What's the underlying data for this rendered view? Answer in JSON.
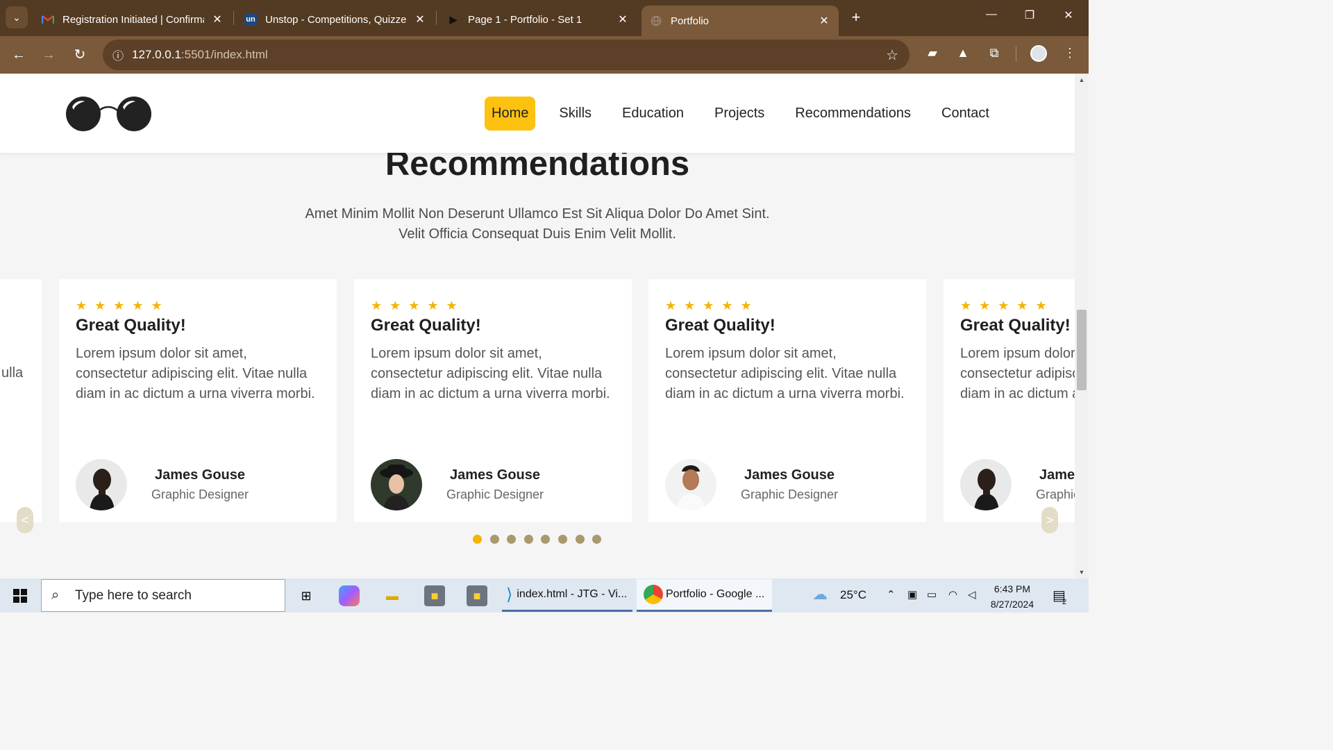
{
  "browser": {
    "tabs": [
      {
        "title": "Registration Initiated | Confirma",
        "icon": "gmail-icon"
      },
      {
        "title": "Unstop - Competitions, Quizzes",
        "icon": "unstop-icon",
        "icon_text": "un"
      },
      {
        "title": "Page 1 - Portfolio - Set 1",
        "icon": "play-icon"
      },
      {
        "title": "Portfolio",
        "icon": "globe-icon"
      }
    ],
    "url_host": "127.0.0.1",
    "url_rest": ":5501/index.html"
  },
  "site": {
    "nav": [
      "Home",
      "Skills",
      "Education",
      "Projects",
      "Recommendations",
      "Contact"
    ],
    "active_nav": "Home",
    "section_title": "Recommendations",
    "section_sub_1": "Amet Minim Mollit Non Deserunt Ullamco Est Sit Aliqua Dolor Do Amet Sint.",
    "section_sub_2": "Velit Officia Consequat Duis Enim Velit Mollit.",
    "left_fragment": "ulla",
    "cards": [
      {
        "stars": "★ ★ ★ ★ ★",
        "title": "Great Quality!",
        "text": "Lorem ipsum dolor sit amet, consectetur adipiscing elit. Vitae nulla diam in ac dictum a urna viverra morbi.",
        "name": "James Gouse",
        "role": "Graphic Designer"
      },
      {
        "stars": "★ ★ ★ ★ ★",
        "title": "Great Quality!",
        "text": "Lorem ipsum dolor sit amet, consectetur adipiscing elit. Vitae nulla diam in ac dictum a urna viverra morbi.",
        "name": "James Gouse",
        "role": "Graphic Designer"
      },
      {
        "stars": "★ ★ ★ ★ ★",
        "title": "Great Quality!",
        "text": "Lorem ipsum dolor sit amet, consectetur adipiscing elit. Vitae nulla diam in ac dictum a urna viverra morbi.",
        "name": "James Gouse",
        "role": "Graphic Designer"
      },
      {
        "stars": "★ ★ ★ ★ ★",
        "title": "Great Quality!",
        "text": "Lorem ipsum dolor sit amet, consectetur adipiscing elit. Vitae nulla diam in ac dictum a urna viverra morbi.",
        "name": "James Gouse",
        "role": "Graphic Designer"
      }
    ],
    "prev_label": "<",
    "next_label": ">",
    "dot_count": 8,
    "active_dot": 1
  },
  "taskbar": {
    "search_placeholder": "Type here to search",
    "apps": [
      {
        "label": "index.html - JTG - Vi...",
        "icon": "vscode-icon"
      },
      {
        "label": "Portfolio - Google ...",
        "icon": "chrome-icon"
      }
    ],
    "weather": "25°C",
    "time": "6:43 PM",
    "date": "8/27/2024",
    "notification_count": "2"
  },
  "colors": {
    "accent": "#fdc110",
    "star": "#f4b400",
    "chrome_dark": "#533a22",
    "chrome_mid": "#7a5a3a"
  }
}
